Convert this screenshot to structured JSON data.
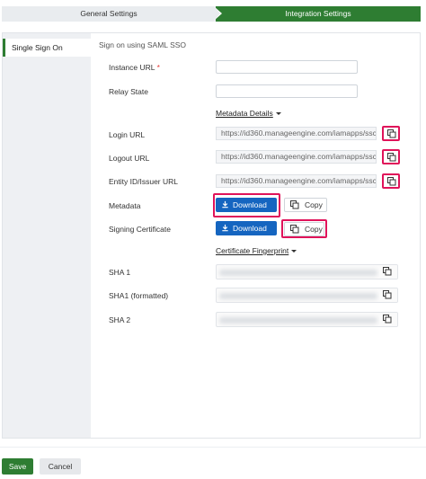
{
  "stepper": {
    "step1": "General Settings",
    "step2": "Integration Settings"
  },
  "sidebar": {
    "items": [
      {
        "label": "Single Sign On"
      }
    ]
  },
  "section_title": "Sign on using SAML SSO",
  "form": {
    "instance_url_label": "Instance URL",
    "required_mark": "*",
    "instance_url_value": "",
    "relay_state_label": "Relay State",
    "relay_state_value": "",
    "metadata_details_link": "Metadata Details",
    "login_url_label": "Login URL",
    "login_url_value": "https://id360.manageengine.com/iamapps/ssc",
    "logout_url_label": "Logout URL",
    "logout_url_value": "https://id360.manageengine.com/iamapps/ssc",
    "entity_id_label": "Entity ID/Issuer URL",
    "entity_id_value": "https://id360.manageengine.com/iamapps/ssc",
    "metadata_label": "Metadata",
    "signing_cert_label": "Signing Certificate",
    "download_label": "Download",
    "copy_label": "Copy",
    "cert_fingerprint_link": "Certificate Fingerprint",
    "sha1_label": "SHA 1",
    "sha1_formatted_label": "SHA1 (formatted)",
    "sha2_label": "SHA 2"
  },
  "footer": {
    "save_label": "Save",
    "cancel_label": "Cancel"
  },
  "colors": {
    "accent_green": "#2e7d32",
    "primary_blue": "#1565c0",
    "highlight_pink": "#e0135a"
  },
  "icons": {
    "copy": "copy-icon",
    "download": "download-icon",
    "caret": "caret-down-icon"
  }
}
